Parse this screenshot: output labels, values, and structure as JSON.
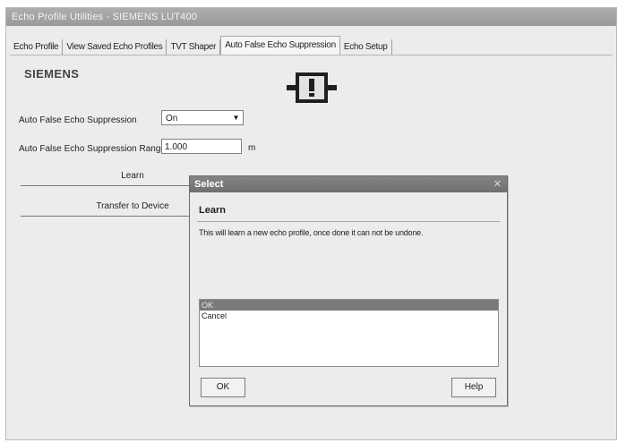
{
  "window": {
    "title": "Echo Profile Utilities - SIEMENS LUT400"
  },
  "tabs": [
    {
      "label": "Echo Profile"
    },
    {
      "label": "View Saved Echo Profiles"
    },
    {
      "label": "TVT Shaper"
    },
    {
      "label": "Auto False Echo Suppression"
    },
    {
      "label": "Echo Setup"
    }
  ],
  "brand": "SIEMENS",
  "form": {
    "afes_label": "Auto False Echo Suppression",
    "afes_value": "On",
    "range_label": "Auto False Echo Suppression Range",
    "range_value": "1.000",
    "range_unit": "m",
    "learn_button": "Learn",
    "transfer_button": "Transfer to Device"
  },
  "dialog": {
    "title": "Select",
    "heading": "Learn",
    "message": "This will learn a new echo profile, once done it can not be undone.",
    "options": [
      "OK",
      "Cancel"
    ],
    "ok_button": "OK",
    "help_button": "Help"
  }
}
